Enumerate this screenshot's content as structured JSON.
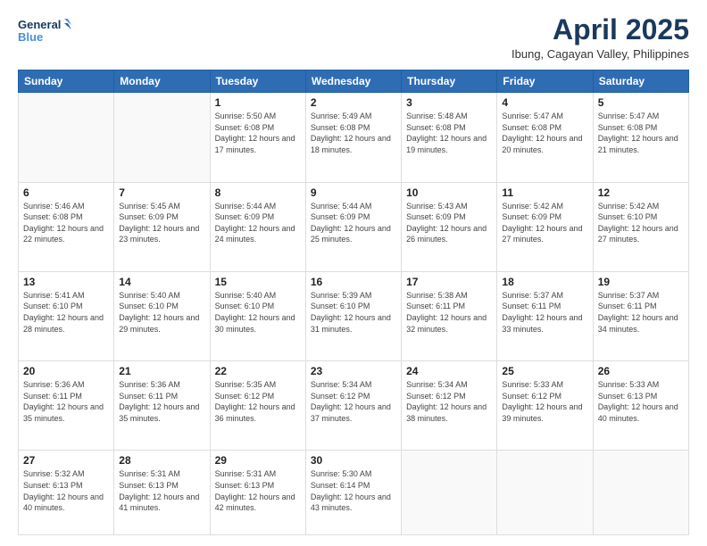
{
  "logo": {
    "line1": "General",
    "line2": "Blue"
  },
  "title": "April 2025",
  "subtitle": "Ibung, Cagayan Valley, Philippines",
  "days_of_week": [
    "Sunday",
    "Monday",
    "Tuesday",
    "Wednesday",
    "Thursday",
    "Friday",
    "Saturday"
  ],
  "weeks": [
    [
      {
        "day": "",
        "sunrise": "",
        "sunset": "",
        "daylight": ""
      },
      {
        "day": "",
        "sunrise": "",
        "sunset": "",
        "daylight": ""
      },
      {
        "day": "1",
        "sunrise": "Sunrise: 5:50 AM",
        "sunset": "Sunset: 6:08 PM",
        "daylight": "Daylight: 12 hours and 17 minutes."
      },
      {
        "day": "2",
        "sunrise": "Sunrise: 5:49 AM",
        "sunset": "Sunset: 6:08 PM",
        "daylight": "Daylight: 12 hours and 18 minutes."
      },
      {
        "day": "3",
        "sunrise": "Sunrise: 5:48 AM",
        "sunset": "Sunset: 6:08 PM",
        "daylight": "Daylight: 12 hours and 19 minutes."
      },
      {
        "day": "4",
        "sunrise": "Sunrise: 5:47 AM",
        "sunset": "Sunset: 6:08 PM",
        "daylight": "Daylight: 12 hours and 20 minutes."
      },
      {
        "day": "5",
        "sunrise": "Sunrise: 5:47 AM",
        "sunset": "Sunset: 6:08 PM",
        "daylight": "Daylight: 12 hours and 21 minutes."
      }
    ],
    [
      {
        "day": "6",
        "sunrise": "Sunrise: 5:46 AM",
        "sunset": "Sunset: 6:08 PM",
        "daylight": "Daylight: 12 hours and 22 minutes."
      },
      {
        "day": "7",
        "sunrise": "Sunrise: 5:45 AM",
        "sunset": "Sunset: 6:09 PM",
        "daylight": "Daylight: 12 hours and 23 minutes."
      },
      {
        "day": "8",
        "sunrise": "Sunrise: 5:44 AM",
        "sunset": "Sunset: 6:09 PM",
        "daylight": "Daylight: 12 hours and 24 minutes."
      },
      {
        "day": "9",
        "sunrise": "Sunrise: 5:44 AM",
        "sunset": "Sunset: 6:09 PM",
        "daylight": "Daylight: 12 hours and 25 minutes."
      },
      {
        "day": "10",
        "sunrise": "Sunrise: 5:43 AM",
        "sunset": "Sunset: 6:09 PM",
        "daylight": "Daylight: 12 hours and 26 minutes."
      },
      {
        "day": "11",
        "sunrise": "Sunrise: 5:42 AM",
        "sunset": "Sunset: 6:09 PM",
        "daylight": "Daylight: 12 hours and 27 minutes."
      },
      {
        "day": "12",
        "sunrise": "Sunrise: 5:42 AM",
        "sunset": "Sunset: 6:10 PM",
        "daylight": "Daylight: 12 hours and 27 minutes."
      }
    ],
    [
      {
        "day": "13",
        "sunrise": "Sunrise: 5:41 AM",
        "sunset": "Sunset: 6:10 PM",
        "daylight": "Daylight: 12 hours and 28 minutes."
      },
      {
        "day": "14",
        "sunrise": "Sunrise: 5:40 AM",
        "sunset": "Sunset: 6:10 PM",
        "daylight": "Daylight: 12 hours and 29 minutes."
      },
      {
        "day": "15",
        "sunrise": "Sunrise: 5:40 AM",
        "sunset": "Sunset: 6:10 PM",
        "daylight": "Daylight: 12 hours and 30 minutes."
      },
      {
        "day": "16",
        "sunrise": "Sunrise: 5:39 AM",
        "sunset": "Sunset: 6:10 PM",
        "daylight": "Daylight: 12 hours and 31 minutes."
      },
      {
        "day": "17",
        "sunrise": "Sunrise: 5:38 AM",
        "sunset": "Sunset: 6:11 PM",
        "daylight": "Daylight: 12 hours and 32 minutes."
      },
      {
        "day": "18",
        "sunrise": "Sunrise: 5:37 AM",
        "sunset": "Sunset: 6:11 PM",
        "daylight": "Daylight: 12 hours and 33 minutes."
      },
      {
        "day": "19",
        "sunrise": "Sunrise: 5:37 AM",
        "sunset": "Sunset: 6:11 PM",
        "daylight": "Daylight: 12 hours and 34 minutes."
      }
    ],
    [
      {
        "day": "20",
        "sunrise": "Sunrise: 5:36 AM",
        "sunset": "Sunset: 6:11 PM",
        "daylight": "Daylight: 12 hours and 35 minutes."
      },
      {
        "day": "21",
        "sunrise": "Sunrise: 5:36 AM",
        "sunset": "Sunset: 6:11 PM",
        "daylight": "Daylight: 12 hours and 35 minutes."
      },
      {
        "day": "22",
        "sunrise": "Sunrise: 5:35 AM",
        "sunset": "Sunset: 6:12 PM",
        "daylight": "Daylight: 12 hours and 36 minutes."
      },
      {
        "day": "23",
        "sunrise": "Sunrise: 5:34 AM",
        "sunset": "Sunset: 6:12 PM",
        "daylight": "Daylight: 12 hours and 37 minutes."
      },
      {
        "day": "24",
        "sunrise": "Sunrise: 5:34 AM",
        "sunset": "Sunset: 6:12 PM",
        "daylight": "Daylight: 12 hours and 38 minutes."
      },
      {
        "day": "25",
        "sunrise": "Sunrise: 5:33 AM",
        "sunset": "Sunset: 6:12 PM",
        "daylight": "Daylight: 12 hours and 39 minutes."
      },
      {
        "day": "26",
        "sunrise": "Sunrise: 5:33 AM",
        "sunset": "Sunset: 6:13 PM",
        "daylight": "Daylight: 12 hours and 40 minutes."
      }
    ],
    [
      {
        "day": "27",
        "sunrise": "Sunrise: 5:32 AM",
        "sunset": "Sunset: 6:13 PM",
        "daylight": "Daylight: 12 hours and 40 minutes."
      },
      {
        "day": "28",
        "sunrise": "Sunrise: 5:31 AM",
        "sunset": "Sunset: 6:13 PM",
        "daylight": "Daylight: 12 hours and 41 minutes."
      },
      {
        "day": "29",
        "sunrise": "Sunrise: 5:31 AM",
        "sunset": "Sunset: 6:13 PM",
        "daylight": "Daylight: 12 hours and 42 minutes."
      },
      {
        "day": "30",
        "sunrise": "Sunrise: 5:30 AM",
        "sunset": "Sunset: 6:14 PM",
        "daylight": "Daylight: 12 hours and 43 minutes."
      },
      {
        "day": "",
        "sunrise": "",
        "sunset": "",
        "daylight": ""
      },
      {
        "day": "",
        "sunrise": "",
        "sunset": "",
        "daylight": ""
      },
      {
        "day": "",
        "sunrise": "",
        "sunset": "",
        "daylight": ""
      }
    ]
  ]
}
